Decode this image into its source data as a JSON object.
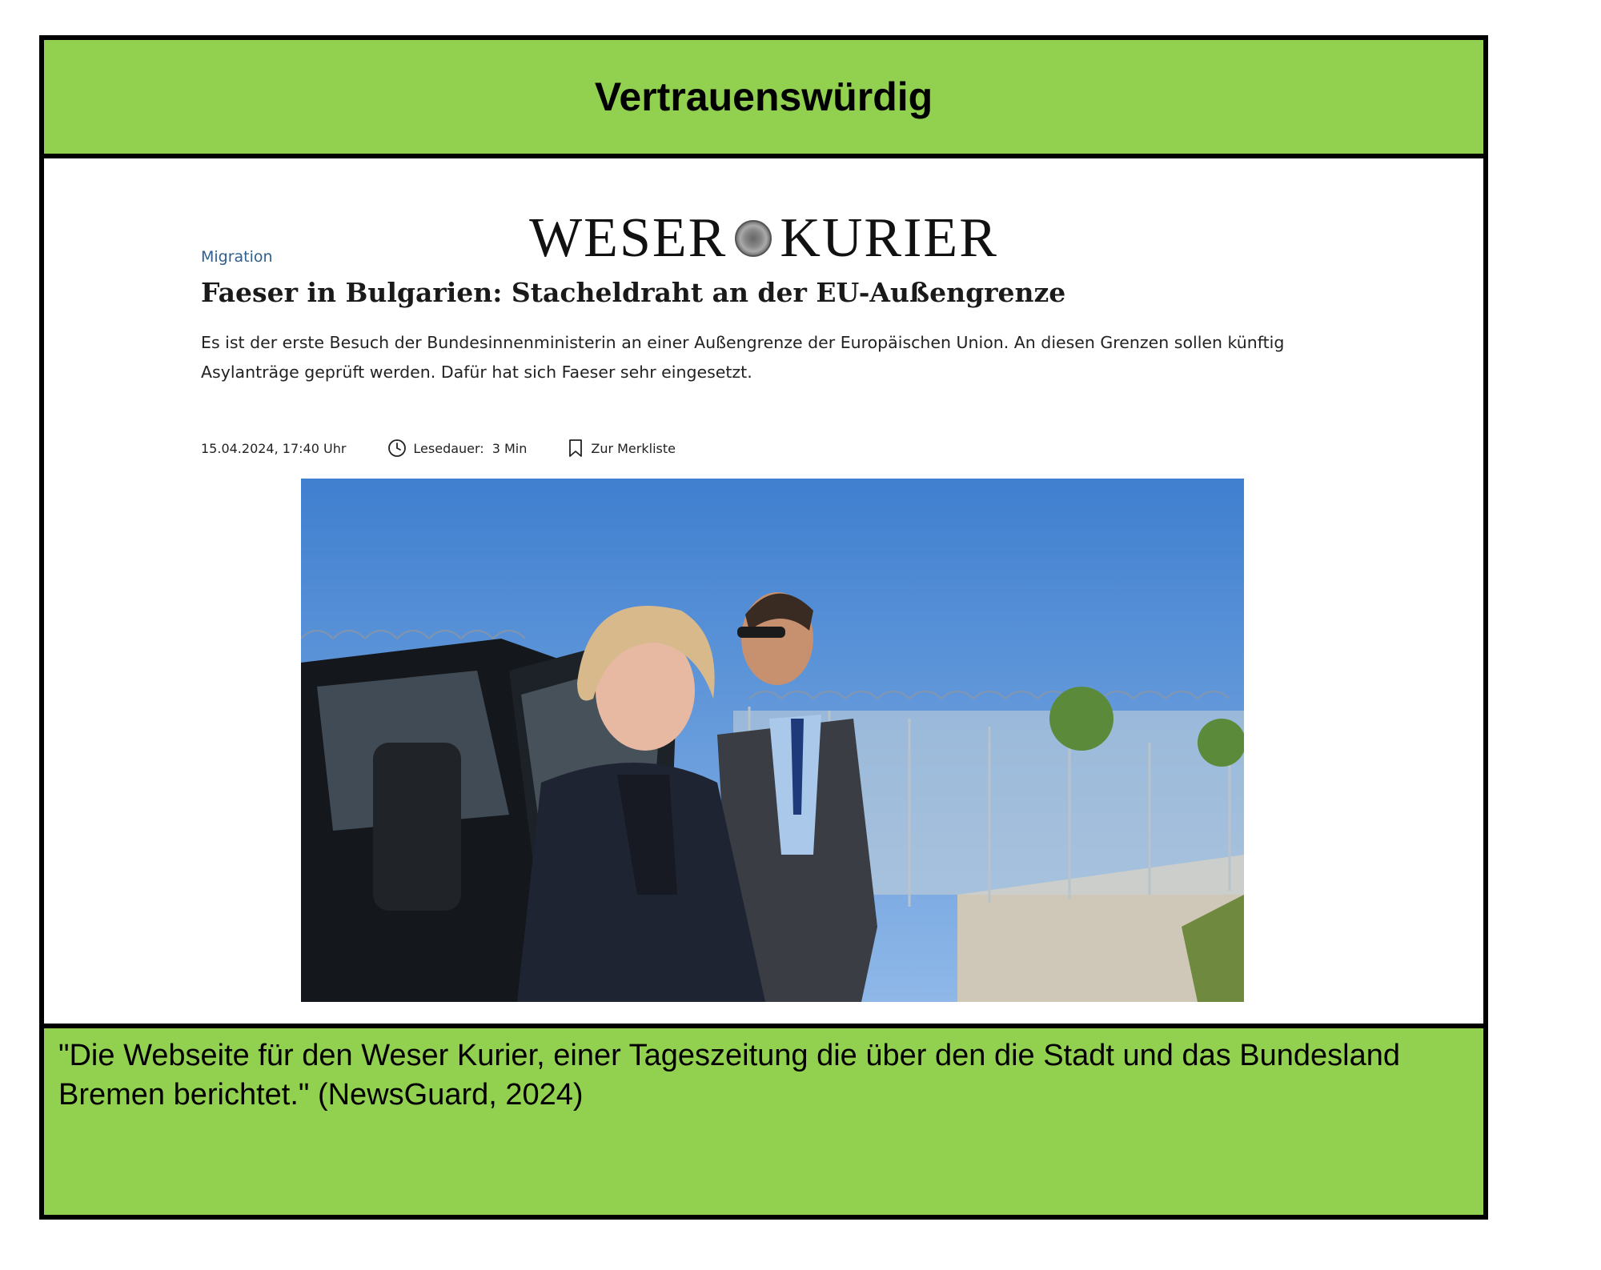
{
  "header": {
    "label": "Vertrauenswürdig"
  },
  "article": {
    "logo_left": "WESER",
    "logo_right": "KURIER",
    "kicker": "Migration",
    "headline": "Faeser in Bulgarien: Stacheldraht an der EU-Außengrenze",
    "teaser": "Es ist der erste Besuch der Bundesinnenministerin an einer Außengrenze der Europäischen Union. An diesen Grenzen sollen künftig Asylanträge geprüft werden. Dafür hat sich Faeser sehr eingesetzt.",
    "date": "15.04.2024, 17:40 Uhr",
    "read_label": "Lesedauer:",
    "read_value": "3 Min",
    "bookmark_label": "Zur Merkliste",
    "icons": {
      "clock": "clock-icon",
      "bookmark": "bookmark-icon",
      "seal": "seal-icon"
    }
  },
  "footer": {
    "quote": "\"Die Webseite für den Weser Kurier, einer Tageszeitung die über den die Stadt und das Bundesland Bremen berichtet.\" (NewsGuard, 2024)"
  },
  "colors": {
    "band_green": "#92d050",
    "kicker_blue": "#2f5f8e",
    "border": "#000000"
  }
}
